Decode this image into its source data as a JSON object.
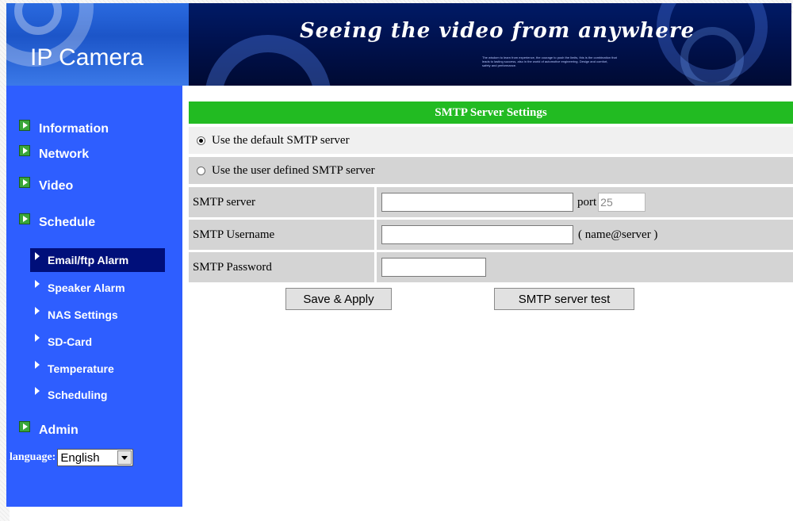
{
  "banner": {
    "title": "IP Camera",
    "slogan": "Seeing the video from anywhere",
    "fine_print": "The wisdom to learn from experience, the courage to push the limits, this is the combination that leads to lasting success, also in the world of automotive engineering. Design and comfort, safety and performance."
  },
  "sidebar": {
    "items": [
      {
        "label": "Information",
        "icon": "green-arrow-icon"
      },
      {
        "label": "Network",
        "icon": "green-arrow-icon"
      },
      {
        "label": "Video",
        "icon": "green-arrow-icon"
      },
      {
        "label": "Schedule",
        "icon": "green-arrow-icon"
      },
      {
        "label": "Admin",
        "icon": "green-arrow-icon"
      }
    ],
    "sub_items": [
      {
        "label": "Email/ftp Alarm",
        "active": true
      },
      {
        "label": "Speaker Alarm"
      },
      {
        "label": "NAS Settings"
      },
      {
        "label": "SD-Card"
      },
      {
        "label": "Temperature"
      },
      {
        "label": "Scheduling"
      }
    ],
    "language_label": "language:",
    "language_value": "English"
  },
  "main": {
    "header": "SMTP Server Settings",
    "radio_default": "Use the default SMTP server",
    "radio_default_checked": true,
    "radio_user": "Use the user defined SMTP server",
    "radio_user_checked": false,
    "fields": {
      "server_label": "SMTP server",
      "server_value": "",
      "port_label": "port",
      "port_value": "25",
      "username_label": "SMTP Username",
      "username_value": "",
      "username_hint": "( name@server )",
      "password_label": "SMTP Password",
      "password_value": ""
    },
    "buttons": {
      "save": "Save & Apply",
      "test": "SMTP server test"
    }
  },
  "colors": {
    "sidebar": "#2e5eff",
    "active_sub": "#000f7a",
    "header_bar": "#22bb22",
    "row": "#d4d4d4"
  }
}
